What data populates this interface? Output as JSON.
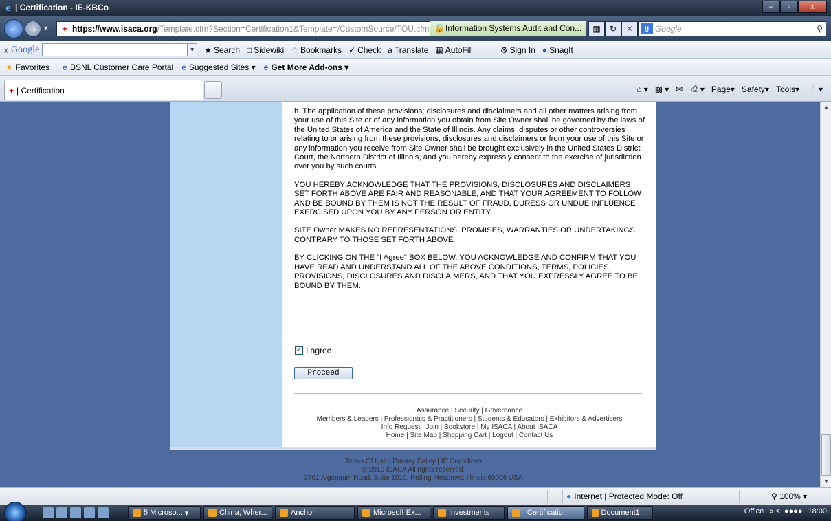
{
  "window": {
    "title": "| Certification - IE-KBCo",
    "buttons": [
      "–",
      "▫",
      "x"
    ]
  },
  "address": {
    "scheme": "https://",
    "domain": "www.isaca.org",
    "path": "/Template.cfm?Section=Certification1&Template=/CustomSource/TOU.cfm",
    "identity": "Information Systems Audit and Con...",
    "search_placeholder": "Google"
  },
  "google_toolbar": {
    "logo": "Google",
    "items": [
      "Search",
      "Sidewiki",
      "Bookmarks",
      "Check",
      "Translate",
      "AutoFill",
      "Sign In",
      "SnagIt"
    ]
  },
  "links_bar": {
    "favorites": "Favorites",
    "links": [
      "BSNL Customer Care Portal",
      "Suggested Sites",
      "Get More Add-ons"
    ]
  },
  "tab": {
    "title": "| Certification"
  },
  "command_bar": {
    "items": [
      "Page",
      "Safety",
      "Tools"
    ]
  },
  "terms": {
    "paragraphs": [
      "h. The application of these provisions, disclosures and disclaimers and all other matters arising from your use of this Site or of any information you obtain from Site Owner shall be governed by the laws of the United States of America and the State of Illinois. Any claims, disputes or other controversies relating to or arising from these provisions, disclosures and disclaimers or from your use of this Site or any information you receive from Site Owner shall be brought exclusively in the United States District Court, the Northern District of Illinois, and you hereby expressly consent to the exercise of jurisdiction over you by such courts.",
      "YOU HEREBY ACKNOWLEDGE THAT THE PROVISIONS, DISCLOSURES AND DISCLAIMERS SET FORTH ABOVE ARE FAIR AND REASONABLE, AND THAT YOUR AGREEMENT TO FOLLOW AND BE BOUND BY THEM IS NOT THE RESULT OF FRAUD, DURESS OR UNDUE INFLUENCE EXERCISED UPON YOU BY ANY PERSON OR ENTITY.",
      "SITE Owner MAKES NO REPRESENTATIONS, PROMISES, WARRANTIES OR UNDERTAKINGS CONTRARY TO THOSE SET FORTH ABOVE.",
      "BY CLICKING ON THE \"I Agree\" BOX BELOW, YOU ACKNOWLEDGE AND CONFIRM THAT YOU HAVE READ AND UNDERSTAND ALL OF THE ABOVE CONDITIONS, TERMS, POLICIES, PROVISIONS, DISCLOSURES AND DISCLAIMERS, AND THAT YOU EXPRESSLY AGREE TO BE BOUND BY THEM."
    ],
    "agree_label": "I agree",
    "agree_checked": true,
    "proceed_label": "Proceed"
  },
  "footer": {
    "line1": "Assurance | Security | Governance",
    "line2": "Members & Leaders | Professionals & Practitioners | Students & Educators | Exhibitors & Advertisers",
    "line3": "Info Request | Join | Bookstore | My ISACA | About ISACA",
    "line4": "Home | Site Map | Shopping Cart | Logout | Contact Us"
  },
  "bottom_footer": {
    "line1": "Terms Of Use | Privacy Policy | IP Guidelines",
    "line2": "© 2010 ISACA All rights reserved.",
    "line3": "3701 Algonquin Road, Suite 1010, Rolling Meadows, Illinois 60008 USA"
  },
  "status": {
    "zone": "Internet | Protected Mode: Off",
    "zoom": "100%"
  },
  "taskbar": {
    "tasks": [
      "5 Microso...",
      "China, Wher...",
      "Anchor",
      "Microsoft Ex...",
      "Investments",
      "| Certificatio...",
      "Document1 ..."
    ],
    "office": "Office",
    "clock": "18:00"
  },
  "colors": {
    "page_bg": "#4e6ba0",
    "left_column": "#b7d6f2",
    "content_bg": "#ffffff"
  }
}
